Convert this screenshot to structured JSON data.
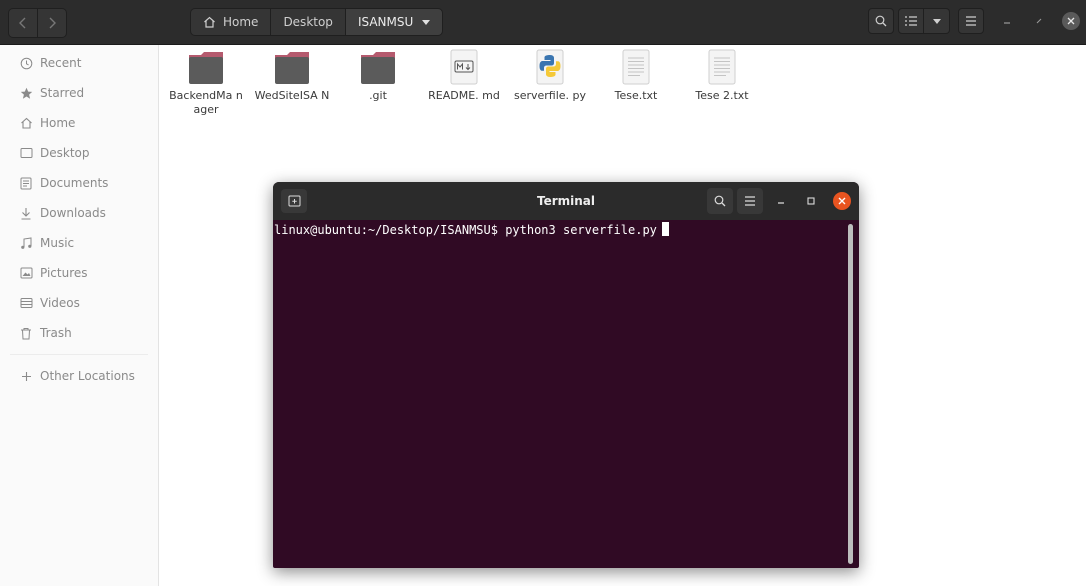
{
  "header": {
    "back_icon": "chevron-left-icon",
    "forward_icon": "chevron-right-icon",
    "path": [
      {
        "label": "Home",
        "icon": "home-icon"
      },
      {
        "label": "Desktop"
      },
      {
        "label": "ISANMSU",
        "icon": "dropdown-arrow-icon"
      }
    ],
    "controls": [
      "search-icon",
      "view-list-icon",
      "view-options-icon",
      "menu-icon",
      "minimize-icon",
      "maximize-icon",
      "close-icon"
    ]
  },
  "sidebar": {
    "items": [
      {
        "label": "Recent",
        "icon": "clock-icon"
      },
      {
        "label": "Starred",
        "icon": "star-icon"
      },
      {
        "label": "Home",
        "icon": "home-icon"
      },
      {
        "label": "Desktop",
        "icon": "desktop-icon"
      },
      {
        "label": "Documents",
        "icon": "documents-icon"
      },
      {
        "label": "Downloads",
        "icon": "download-icon"
      },
      {
        "label": "Music",
        "icon": "music-icon"
      },
      {
        "label": "Pictures",
        "icon": "pictures-icon"
      },
      {
        "label": "Videos",
        "icon": "videos-icon"
      },
      {
        "label": "Trash",
        "icon": "trash-icon"
      }
    ],
    "other_locations": {
      "label": "Other Locations",
      "icon": "plus-icon"
    }
  },
  "files": [
    {
      "name": "BackendMa nager",
      "type": "folder",
      "icon": "folder-icon"
    },
    {
      "name": "WedSiteISA N",
      "type": "folder",
      "icon": "folder-icon"
    },
    {
      "name": ".git",
      "type": "folder",
      "icon": "folder-icon"
    },
    {
      "name": "README. md",
      "type": "markdown",
      "icon": "markdown-file-icon"
    },
    {
      "name": "serverfile. py",
      "type": "python",
      "icon": "python-file-icon"
    },
    {
      "name": "Tese.txt",
      "type": "text",
      "icon": "text-file-icon"
    },
    {
      "name": "Tese 2.txt",
      "type": "text",
      "icon": "text-file-icon"
    }
  ],
  "terminal": {
    "title": "Terminal",
    "prompt": "linux@ubuntu:~/Desktop/ISANMSU$ python3 serverfile.py",
    "controls": [
      "new-tab-icon",
      "search-icon",
      "menu-icon",
      "minimize-icon",
      "maximize-icon",
      "close-icon"
    ]
  },
  "colors": {
    "terminal_bg": "#300a24",
    "close_accent": "#e95420",
    "folder": "#5b5b5b",
    "folder_tab": "#b55a6e"
  }
}
